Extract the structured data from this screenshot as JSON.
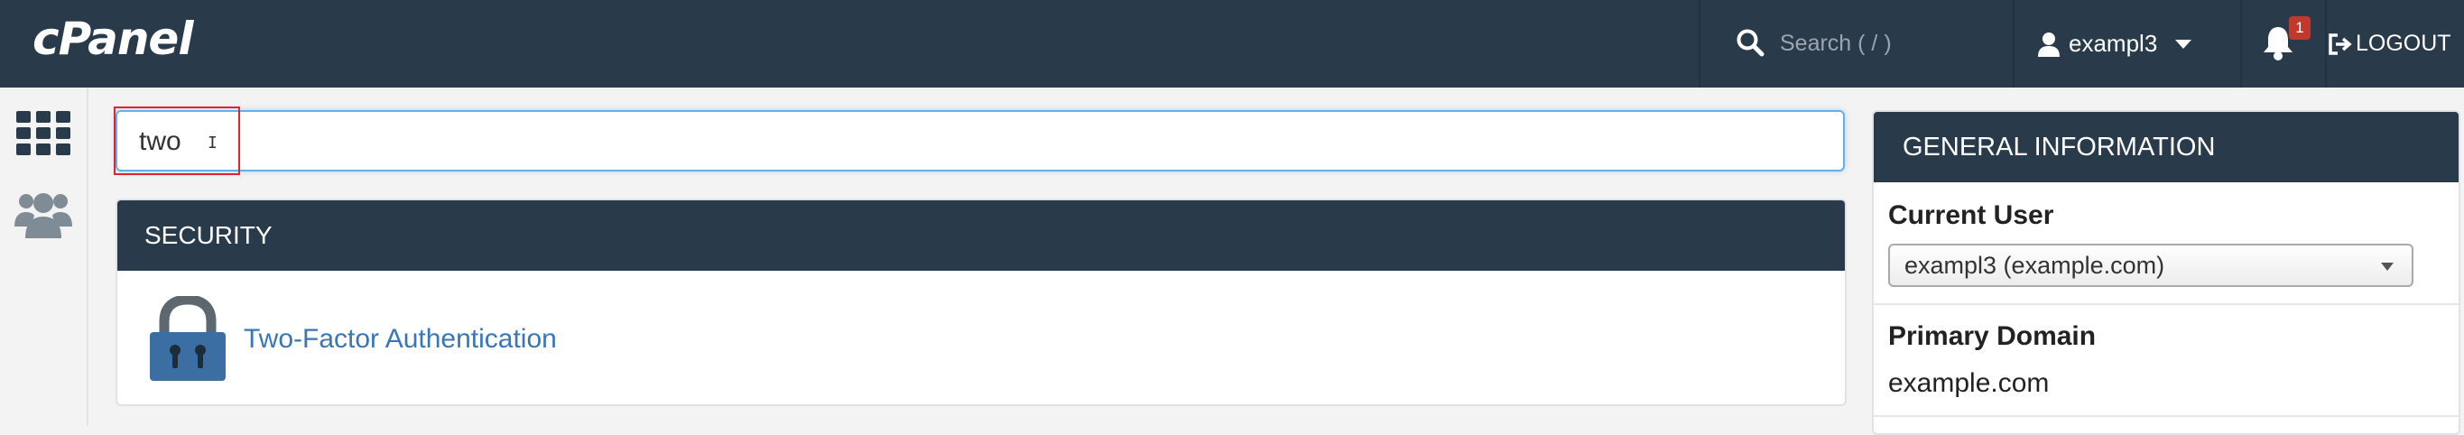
{
  "header": {
    "logo_text": "cPanel",
    "search_placeholder": "Search ( / )",
    "username": "exampl3",
    "notification_count": "1",
    "logout_label": "LOGOUT"
  },
  "sidebar": {
    "items": [
      {
        "icon": "grid-icon"
      },
      {
        "icon": "users-icon"
      }
    ]
  },
  "filter": {
    "value": "two"
  },
  "results": {
    "section_title": "SECURITY",
    "items": [
      {
        "label": "Two-Factor Authentication",
        "icon": "lock-icon"
      }
    ]
  },
  "general_info": {
    "title": "GENERAL INFORMATION",
    "current_user_label": "Current User",
    "current_user_value": "exampl3 (example.com)",
    "primary_domain_label": "Primary Domain",
    "primary_domain_value": "example.com"
  },
  "colors": {
    "topbar": "#293a4a",
    "link": "#3876b7",
    "focus": "#66afe9",
    "badge": "#c0392b"
  }
}
